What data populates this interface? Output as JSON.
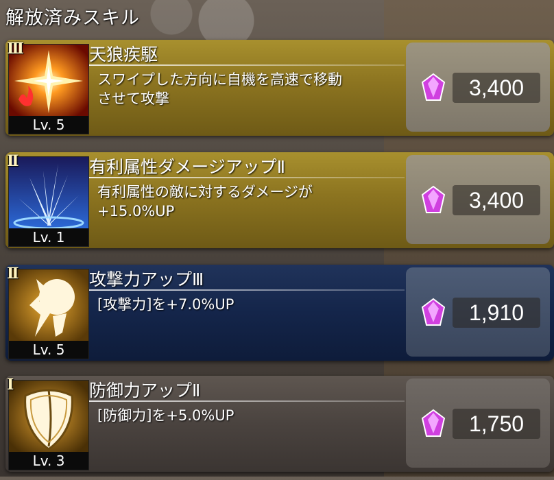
{
  "header": {
    "title": "解放済みスキル"
  },
  "skills": [
    {
      "rank": "III",
      "name": "天狼疾駆",
      "desc1": "スワイプした方向に自機を高速で移動",
      "desc2": "させて攻撃",
      "level": "Lv. 5",
      "cost": "3,400",
      "icon": "star-burst-icon",
      "theme": "gold"
    },
    {
      "rank": "II",
      "name": "有利属性ダメージアップⅡ",
      "desc1": "有利属性の敵に対するダメージが",
      "desc2": "+15.0%UP",
      "level": "Lv. 1",
      "cost": "3,400",
      "icon": "ice-spike-icon",
      "theme": "gold"
    },
    {
      "rank": "II",
      "name": "攻撃力アップⅢ",
      "desc1": "[攻撃力]を+7.0%UP",
      "desc2": "",
      "level": "Lv. 5",
      "cost": "1,910",
      "icon": "fist-icon",
      "theme": "blue"
    },
    {
      "rank": "I",
      "name": "防御力アップⅡ",
      "desc1": "[防御力]を+5.0%UP",
      "desc2": "",
      "level": "Lv. 3",
      "cost": "1,750",
      "icon": "shield-icon",
      "theme": "gray"
    }
  ],
  "currency_icon": "purple-gem-icon"
}
